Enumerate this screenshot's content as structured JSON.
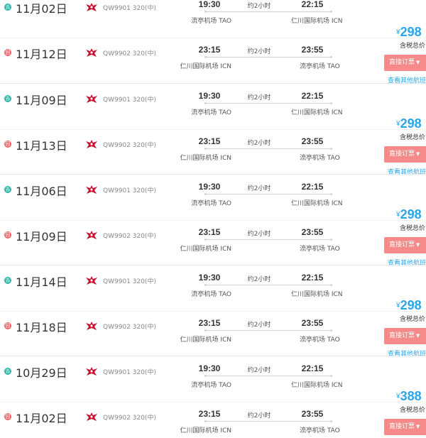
{
  "icons": {
    "outbound": "go-icon",
    "return": "return-icon",
    "airline": "airline-logo-icon",
    "caret": "caret-down-icon"
  },
  "colors": {
    "price": "#2ba6ea",
    "book_button": "#f7898a",
    "outbound_badge": "#2ab3a6",
    "return_badge": "#ee5f5f",
    "airline_logo": "#c8102e"
  },
  "labels": {
    "outbound_badge": "去",
    "return_badge": "回",
    "tax_label": "含税总价",
    "book_button": "直接订票",
    "other_link": "查看其他航班",
    "currency": "¥"
  },
  "itineraries": [
    {
      "price": "298",
      "outbound": {
        "date": "11月02日",
        "flight": "QW9901 320(中)",
        "dep_time": "19:30",
        "dep_airport": "流亭机场 TAO",
        "duration": "约2小时",
        "arr_time": "22:15",
        "arr_airport": "仁川国际机场 ICN"
      },
      "return": {
        "date": "11月12日",
        "flight": "QW9902 320(中)",
        "dep_time": "23:15",
        "dep_airport": "仁川国际机场 ICN",
        "duration": "约2小时",
        "arr_time": "23:55",
        "arr_airport": "流亭机场 TAO"
      }
    },
    {
      "price": "298",
      "outbound": {
        "date": "11月09日",
        "flight": "QW9901 320(中)",
        "dep_time": "19:30",
        "dep_airport": "流亭机场 TAO",
        "duration": "约2小时",
        "arr_time": "22:15",
        "arr_airport": "仁川国际机场 ICN"
      },
      "return": {
        "date": "11月13日",
        "flight": "QW9902 320(中)",
        "dep_time": "23:15",
        "dep_airport": "仁川国际机场 ICN",
        "duration": "约2小时",
        "arr_time": "23:55",
        "arr_airport": "流亭机场 TAO"
      }
    },
    {
      "price": "298",
      "outbound": {
        "date": "11月06日",
        "flight": "QW9901 320(中)",
        "dep_time": "19:30",
        "dep_airport": "流亭机场 TAO",
        "duration": "约2小时",
        "arr_time": "22:15",
        "arr_airport": "仁川国际机场 ICN"
      },
      "return": {
        "date": "11月09日",
        "flight": "QW9902 320(中)",
        "dep_time": "23:15",
        "dep_airport": "仁川国际机场 ICN",
        "duration": "约2小时",
        "arr_time": "23:55",
        "arr_airport": "流亭机场 TAO"
      }
    },
    {
      "price": "298",
      "outbound": {
        "date": "11月14日",
        "flight": "QW9901 320(中)",
        "dep_time": "19:30",
        "dep_airport": "流亭机场 TAO",
        "duration": "约2小时",
        "arr_time": "22:15",
        "arr_airport": "仁川国际机场 ICN"
      },
      "return": {
        "date": "11月18日",
        "flight": "QW9902 320(中)",
        "dep_time": "23:15",
        "dep_airport": "仁川国际机场 ICN",
        "duration": "约2小时",
        "arr_time": "23:55",
        "arr_airport": "流亭机场 TAO"
      }
    },
    {
      "price": "388",
      "outbound": {
        "date": "10月29日",
        "flight": "QW9901 320(中)",
        "dep_time": "19:30",
        "dep_airport": "流亭机场 TAO",
        "duration": "约2小时",
        "arr_time": "22:15",
        "arr_airport": "仁川国际机场 ICN"
      },
      "return": {
        "date": "11月02日",
        "flight": "QW9902 320(中)",
        "dep_time": "23:15",
        "dep_airport": "仁川国际机场 ICN",
        "duration": "约2小时",
        "arr_time": "23:55",
        "arr_airport": "流亭机场 TAO"
      }
    }
  ]
}
